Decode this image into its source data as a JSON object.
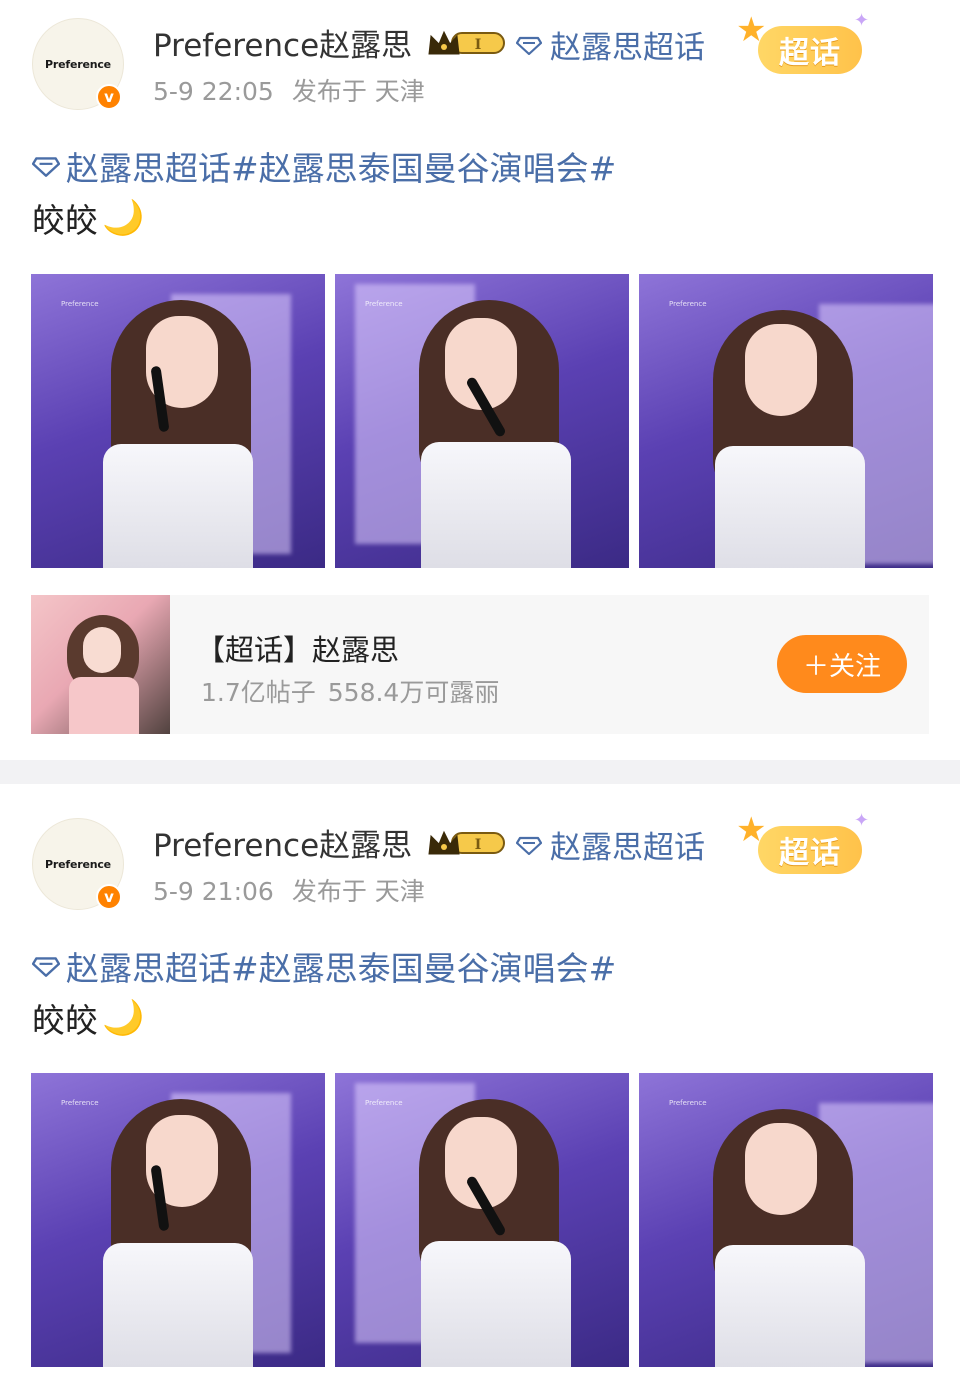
{
  "posts": [
    {
      "avatar_text": "Preference",
      "verified_icon": "v",
      "username": "Preference赵露思",
      "topic_link": "赵露思超话",
      "time": "5-9 22:05",
      "location": "发布于 天津",
      "super_badge": "超话",
      "hashtags": "赵露思超话#赵露思泰国曼谷演唱会#",
      "body": "皎皎",
      "photos": [
        "photo-1",
        "photo-2",
        "photo-3"
      ],
      "card": {
        "title": "【超话】赵露思",
        "posts_count": "1.7亿帖子",
        "fans_count": "558.4万可露丽",
        "follow_label": "＋关注"
      }
    },
    {
      "avatar_text": "Preference",
      "verified_icon": "v",
      "username": "Preference赵露思",
      "topic_link": "赵露思超话",
      "time": "5-9 21:06",
      "location": "发布于 天津",
      "super_badge": "超话",
      "hashtags": "赵露思超话#赵露思泰国曼谷演唱会#",
      "body": "皎皎",
      "photos": [
        "photo-1",
        "photo-2",
        "photo-3"
      ]
    }
  ],
  "colors": {
    "link": "#4a6ea8",
    "accent": "#ff8a1c",
    "meta": "#9a9a9a"
  },
  "icons": [
    "diamond-icon",
    "crown-badge-icon",
    "verified-icon",
    "moon-icon",
    "super-topic-badge"
  ]
}
